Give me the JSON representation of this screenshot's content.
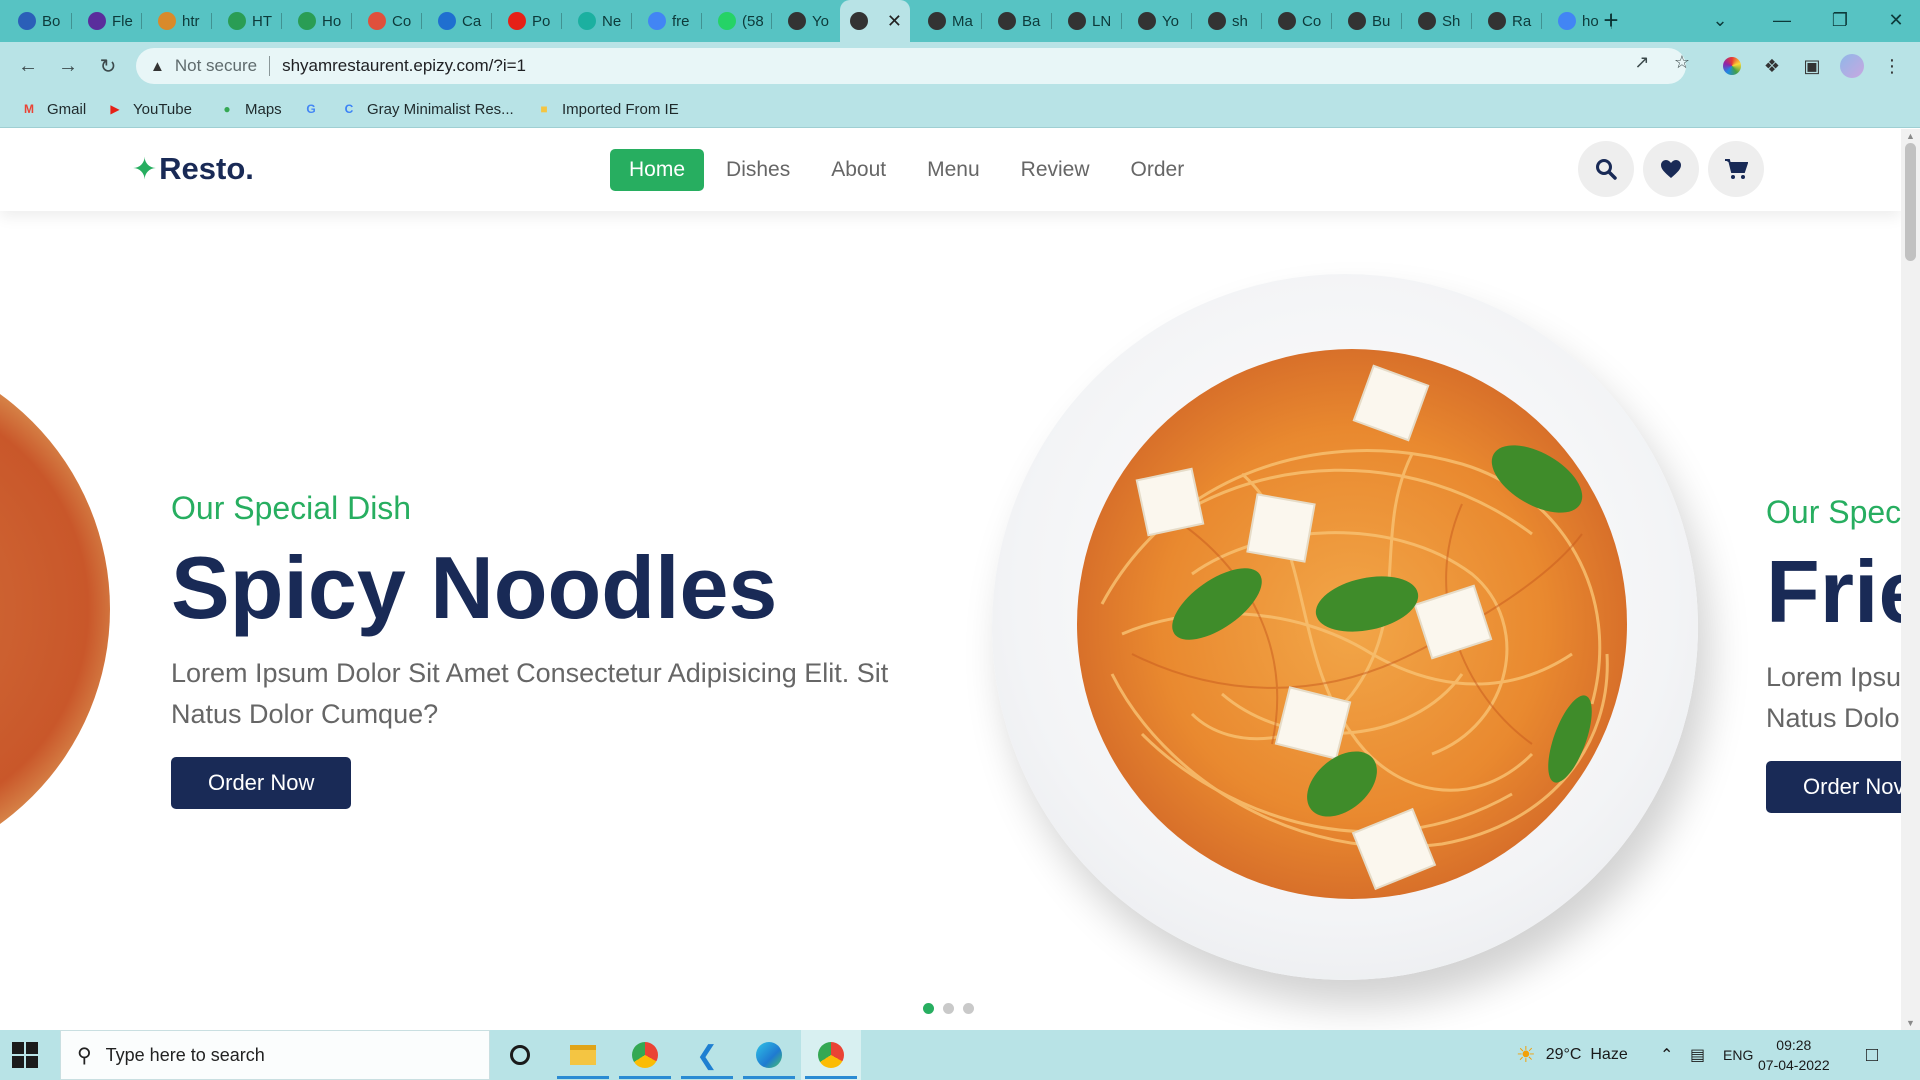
{
  "browser": {
    "tabs": [
      {
        "title": "Bo",
        "favicon": "blue-z-icon",
        "color": "#2b5fb8"
      },
      {
        "title": "Fle",
        "favicon": "bootstrap-icon",
        "color": "#5a2d9c"
      },
      {
        "title": "htr",
        "favicon": "pencil-icon",
        "color": "#d98a2b"
      },
      {
        "title": "HT",
        "favicon": "w3schools-icon",
        "color": "#2a9d54"
      },
      {
        "title": "Ho",
        "favicon": "w3schools-icon",
        "color": "#2a9d54"
      },
      {
        "title": "Co",
        "favicon": "palette-icon",
        "color": "#e0503c"
      },
      {
        "title": "Ca",
        "favicon": "monitor-icon",
        "color": "#1f6fd0"
      },
      {
        "title": "Po",
        "favicon": "youtube-icon",
        "color": "#e62117"
      },
      {
        "title": "Ne",
        "favicon": "diamond-icon",
        "color": "#1bb0a0"
      },
      {
        "title": "fre",
        "favicon": "google-icon",
        "color": "#4285f4"
      },
      {
        "title": "(58",
        "favicon": "whatsapp-icon",
        "color": "#25d366"
      },
      {
        "title": "Yo",
        "favicon": "globe-icon",
        "color": "#333333"
      },
      {
        "title": "",
        "favicon": "globe-icon",
        "color": "#333333",
        "active": true
      },
      {
        "title": "Ma",
        "favicon": "globe-icon",
        "color": "#333333"
      },
      {
        "title": "Ba",
        "favicon": "globe-icon",
        "color": "#333333"
      },
      {
        "title": "LN",
        "favicon": "globe-icon",
        "color": "#333333"
      },
      {
        "title": "Yo",
        "favicon": "globe-icon",
        "color": "#333333"
      },
      {
        "title": "sh",
        "favicon": "globe-icon",
        "color": "#333333"
      },
      {
        "title": "Co",
        "favicon": "globe-icon",
        "color": "#333333"
      },
      {
        "title": "Bu",
        "favicon": "globe-icon",
        "color": "#333333"
      },
      {
        "title": "Sh",
        "favicon": "globe-icon",
        "color": "#333333"
      },
      {
        "title": "Ra",
        "favicon": "globe-icon",
        "color": "#333333"
      },
      {
        "title": "ho",
        "favicon": "google-icon",
        "color": "#4285f4"
      }
    ],
    "address": {
      "security_label": "Not secure",
      "url": "shyamrestaurent.epizy.com/?i=1"
    },
    "bookmarks": [
      {
        "label": "Gmail",
        "icon": "gmail-icon",
        "color": "#ea4335"
      },
      {
        "label": "YouTube",
        "icon": "youtube-icon",
        "color": "#e62117"
      },
      {
        "label": "Maps",
        "icon": "maps-pin-icon",
        "color": "#34a853"
      },
      {
        "label": "",
        "icon": "google-icon",
        "color": "#4285f4"
      },
      {
        "label": "Gray Minimalist Res...",
        "icon": "canva-icon",
        "color": "#3b82f6"
      },
      {
        "label": "Imported From IE",
        "icon": "folder-icon",
        "color": "#f4c542"
      }
    ]
  },
  "site": {
    "logo_text": "Resto.",
    "nav": [
      {
        "label": "Home",
        "active": true
      },
      {
        "label": "Dishes"
      },
      {
        "label": "About"
      },
      {
        "label": "Menu"
      },
      {
        "label": "Review"
      },
      {
        "label": "Order"
      }
    ],
    "header_icons": [
      "search-icon",
      "heart-icon",
      "cart-icon"
    ],
    "slides": [
      {
        "kicker": "Our Special Dish",
        "title": "Spicy Noodles",
        "description": "Lorem Ipsum Dolor Sit Amet Consectetur Adipisicing Elit. Sit Natus Dolor Cumque?",
        "button": "Order Now"
      },
      {
        "kicker": "Our Speci",
        "title": "Frie",
        "description": "Lorem Ipsu Natus Dolo",
        "button": "Order Nov"
      }
    ],
    "slider_dots": 3,
    "active_dot": 0,
    "colors": {
      "accent": "#27ae60",
      "navy": "#192a56",
      "text": "#666666"
    }
  },
  "taskbar": {
    "search_placeholder": "Type here to search",
    "weather": "29°C  Haze",
    "language": "ENG",
    "time": "09:28",
    "date": "07-04-2022"
  }
}
